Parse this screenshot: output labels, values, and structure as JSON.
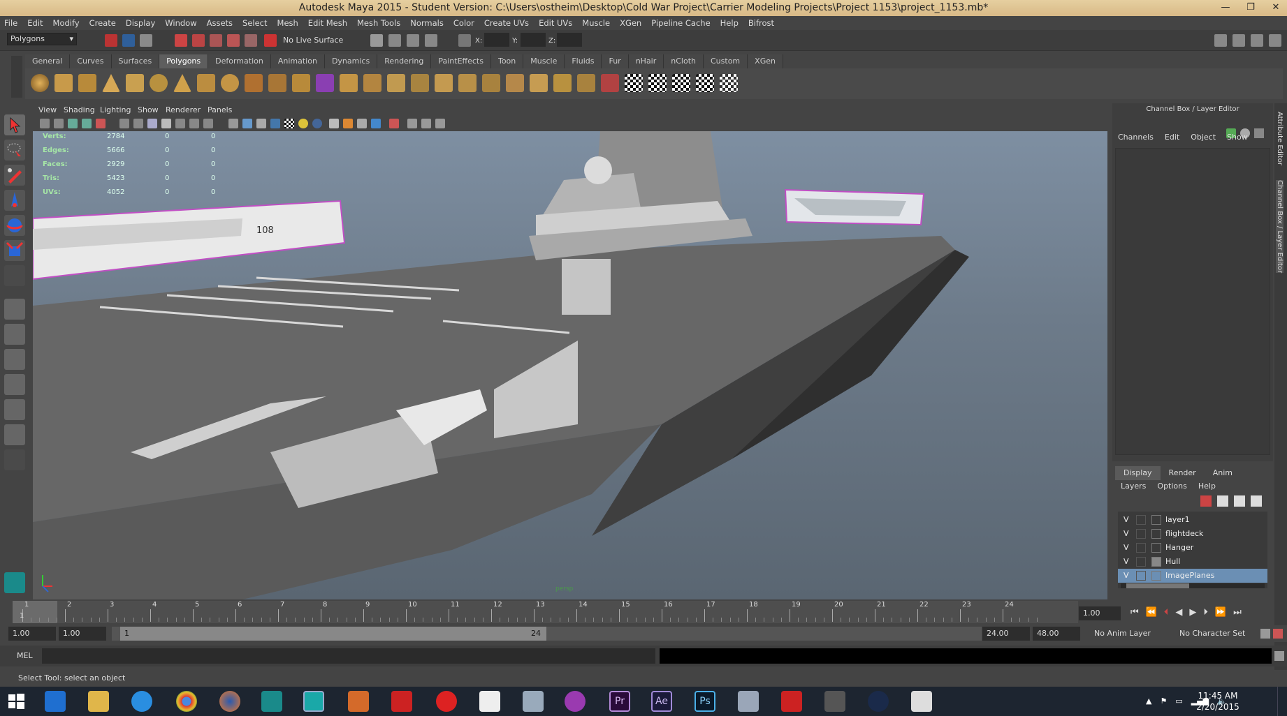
{
  "window": {
    "title": "Autodesk Maya 2015 - Student Version: C:\\Users\\ostheim\\Desktop\\Cold War Project\\Carrier Modeling Projects\\Project 1153\\project_1153.mb*",
    "controls": [
      "—",
      "❐",
      "✕"
    ]
  },
  "menubar": [
    "File",
    "Edit",
    "Modify",
    "Create",
    "Display",
    "Window",
    "Assets",
    "Select",
    "Mesh",
    "Edit Mesh",
    "Mesh Tools",
    "Normals",
    "Color",
    "Create UVs",
    "Edit UVs",
    "Muscle",
    "XGen",
    "Pipeline Cache",
    "Help",
    "Bifrost"
  ],
  "statusline": {
    "mode": "Polygons",
    "live_surface": "No Live Surface",
    "x_label": "X:",
    "y_label": "Y:",
    "z_label": "Z:"
  },
  "shelf_tabs": [
    "General",
    "Curves",
    "Surfaces",
    "Polygons",
    "Deformation",
    "Animation",
    "Dynamics",
    "Rendering",
    "PaintEffects",
    "Toon",
    "Muscle",
    "Fluids",
    "Fur",
    "nHair",
    "nCloth",
    "Custom",
    "XGen"
  ],
  "shelf_active": "Polygons",
  "viewport_menu": [
    "View",
    "Shading",
    "Lighting",
    "Show",
    "Renderer",
    "Panels"
  ],
  "hud": {
    "labels": [
      "Verts:",
      "Edges:",
      "Faces:",
      "Tris:",
      "UVs:"
    ],
    "col1": [
      "2784",
      "5666",
      "2929",
      "5423",
      "4052"
    ],
    "col2": [
      "0",
      "0",
      "0",
      "0",
      "0"
    ],
    "col3": [
      "0",
      "0",
      "0",
      "0",
      "0"
    ],
    "camera": "persp"
  },
  "image_plane_hull_number": "108",
  "channel_box": {
    "title": "Channel Box / Layer Editor",
    "menu": [
      "Channels",
      "Edit",
      "Object",
      "Show"
    ]
  },
  "side_tabs": [
    "Attribute Editor",
    "Channel Box / Layer Editor"
  ],
  "layer_editor": {
    "tabs": [
      "Display",
      "Render",
      "Anim"
    ],
    "active_tab": "Display",
    "menu": [
      "Layers",
      "Options",
      "Help"
    ],
    "layers": [
      {
        "visible": "V",
        "name": "layer1",
        "selected": false
      },
      {
        "visible": "V",
        "name": "flightdeck",
        "selected": false
      },
      {
        "visible": "V",
        "name": "Hanger",
        "selected": false
      },
      {
        "visible": "V",
        "name": "Hull",
        "selected": false
      },
      {
        "visible": "V",
        "name": "ImagePlanes",
        "selected": true
      }
    ]
  },
  "timeslider": {
    "ticks": [
      "1",
      "2",
      "3",
      "4",
      "5",
      "6",
      "7",
      "8",
      "9",
      "10",
      "11",
      "12",
      "13",
      "14",
      "15",
      "16",
      "17",
      "18",
      "19",
      "20",
      "21",
      "22",
      "23",
      "24"
    ],
    "current": "1",
    "current_frame_field": "1.00"
  },
  "range": {
    "start": "1.00",
    "playback_start": "1.00",
    "slider_start": "1",
    "slider_end": "24",
    "playback_end": "24.00",
    "end": "48.00",
    "anim_layer": "No Anim Layer",
    "character_set": "No Character Set"
  },
  "command_line": {
    "lang": "MEL"
  },
  "help_line": "Select Tool: select an object",
  "taskbar": {
    "time": "11:45 AM",
    "date": "2/20/2015"
  }
}
